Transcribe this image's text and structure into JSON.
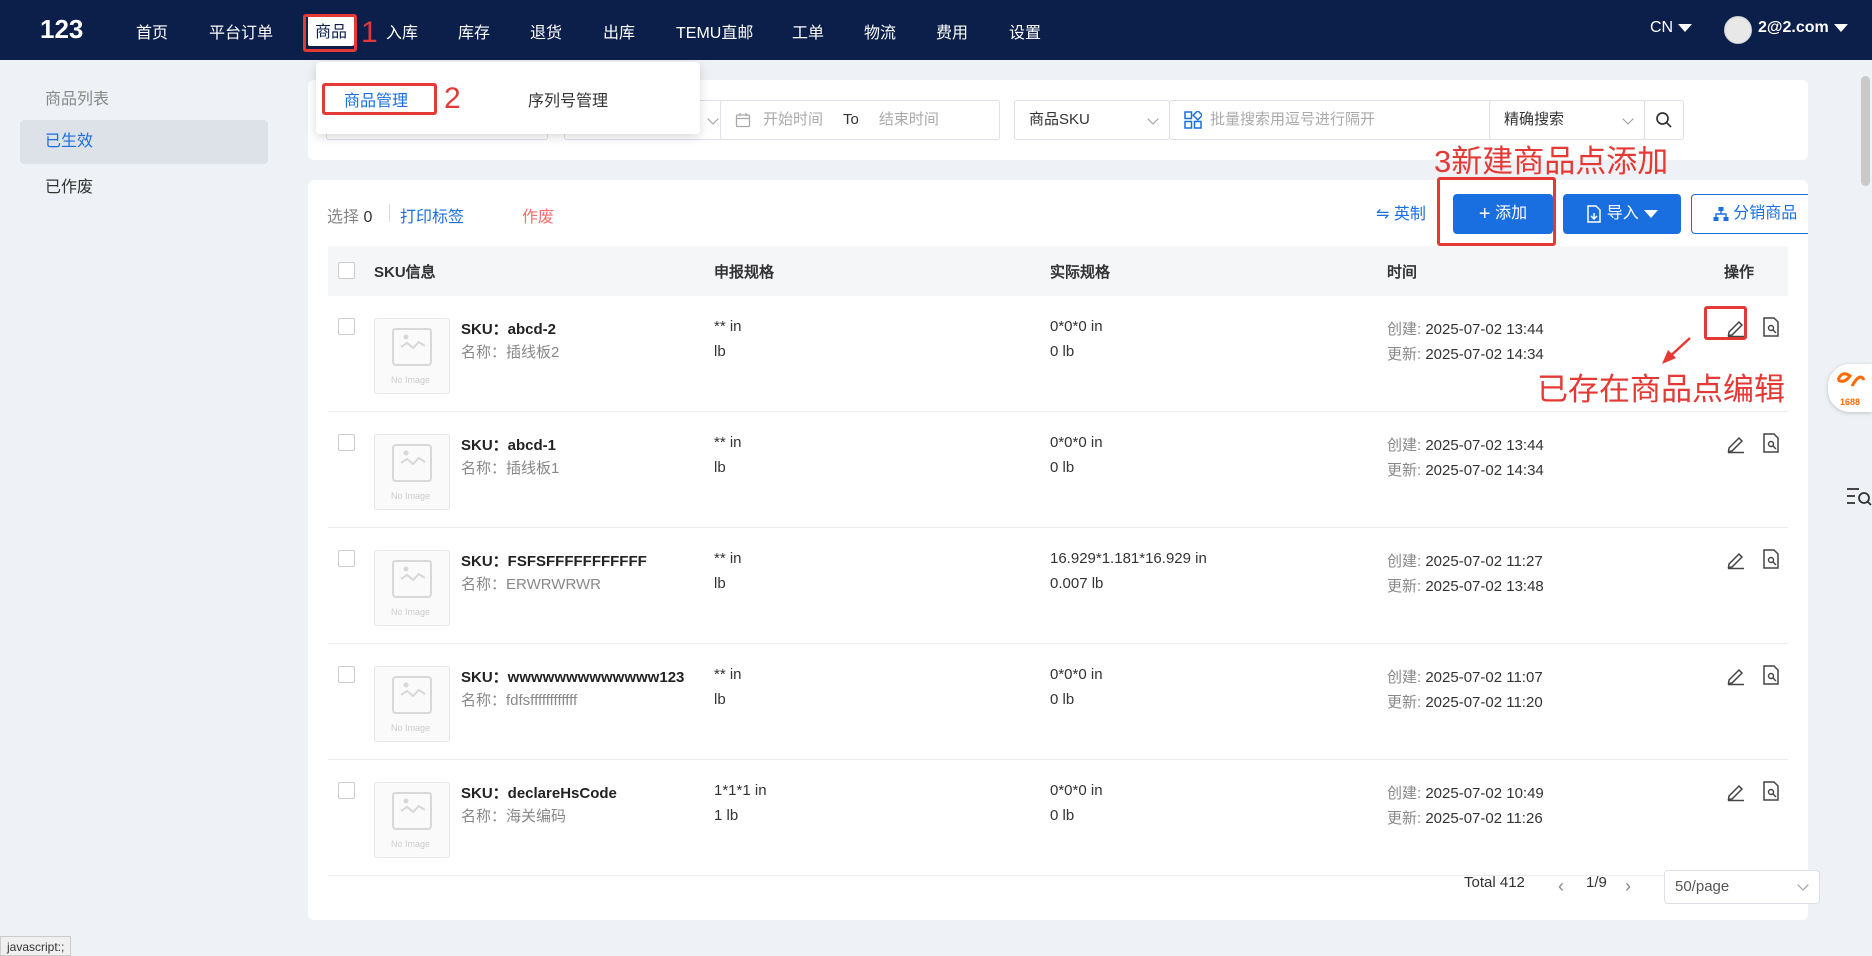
{
  "app": {
    "brand": "123"
  },
  "nav": {
    "items": [
      "首页",
      "平台订单",
      "商品",
      "入库",
      "库存",
      "退货",
      "出库",
      "TEMU直邮",
      "工单",
      "物流",
      "费用",
      "设置"
    ],
    "language": "CN",
    "user": "2@2.com"
  },
  "submenu": {
    "items": [
      "商品管理",
      "序列号管理"
    ]
  },
  "sidebar": {
    "items": [
      "商品列表",
      "已生效",
      "已作废"
    ]
  },
  "filters": {
    "start_placeholder": "开始时间",
    "to_label": "To",
    "end_placeholder": "结束时间",
    "sku_select": "商品SKU",
    "bulk_placeholder": "批量搜索用逗号进行隔开",
    "match_select": "精确搜索"
  },
  "toolbar": {
    "selected_label": "选择",
    "selected_count": "0",
    "print_label": "打印标签",
    "void_label": "作废",
    "unit_label": "英制",
    "add_label": "添加",
    "import_label": "导入",
    "distribute_label": "分销商品"
  },
  "table": {
    "headers": [
      "SKU信息",
      "申报规格",
      "实际规格",
      "时间",
      "操作"
    ],
    "no_image": "No Image",
    "created_label": "创建:",
    "updated_label": "更新:",
    "rows": [
      {
        "sku": "SKU：abcd-2",
        "name": "名称：插线板2",
        "decl1": "** in",
        "decl2": "lb",
        "act1": "0*0*0 in",
        "act2": "0 lb",
        "created": "2025-07-02 13:44",
        "updated": "2025-07-02 14:34"
      },
      {
        "sku": "SKU：abcd-1",
        "name": "名称：插线板1",
        "decl1": "** in",
        "decl2": "lb",
        "act1": "0*0*0 in",
        "act2": "0 lb",
        "created": "2025-07-02 13:44",
        "updated": "2025-07-02 14:34"
      },
      {
        "sku": "SKU：FSFSFFFFFFFFFFF",
        "name": "名称：ERWRWRWR",
        "decl1": "** in",
        "decl2": "lb",
        "act1": "16.929*1.181*16.929 in",
        "act2": "0.007 lb",
        "created": "2025-07-02 11:27",
        "updated": "2025-07-02 13:48"
      },
      {
        "sku": "SKU：wwwwwwwwwwwww123",
        "name": "名称：fdfsffffffffffff",
        "decl1": "** in",
        "decl2": "lb",
        "act1": "0*0*0 in",
        "act2": "0 lb",
        "created": "2025-07-02 11:07",
        "updated": "2025-07-02 11:20"
      },
      {
        "sku": "SKU：declareHsCode",
        "name": "名称：海关编码",
        "decl1": "1*1*1 in",
        "decl2": "1 lb",
        "act1": "0*0*0 in",
        "act2": "0 lb",
        "created": "2025-07-02 10:49",
        "updated": "2025-07-02 11:26"
      }
    ]
  },
  "pagination": {
    "total": "Total 412",
    "page": "1/9",
    "page_size": "50/page"
  },
  "annotations": {
    "n1": "1",
    "n2": "2",
    "n3": "3新建商品点添加",
    "edit": "已存在商品点编辑"
  },
  "side_widget": {
    "badge": "1688"
  },
  "status_bar": "javascript:;",
  "colors": {
    "nav_bg": "#0b1f4a",
    "primary": "#1a6fe0",
    "annotation": "#e53935",
    "void": "#f56c6c"
  }
}
